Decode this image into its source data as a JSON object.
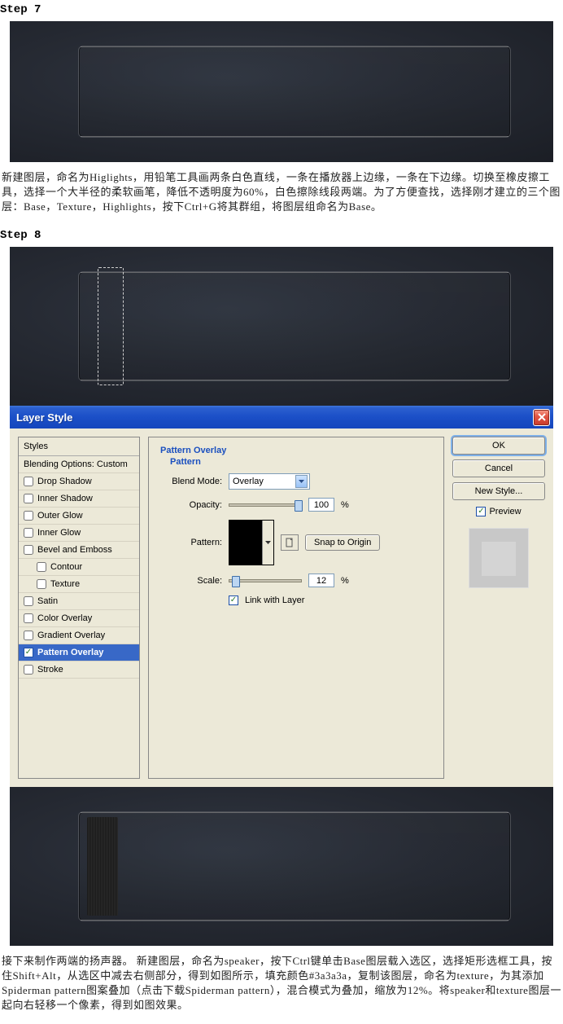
{
  "step7_heading": "Step 7",
  "step7_para": "新建图层，命名为Higlights，用铅笔工具画两条白色直线，一条在播放器上边缘，一条在下边缘。切换至橡皮擦工具，选择一个大半径的柔软画笔，降低不透明度为60%，白色擦除线段两端。为了方便查找，选择刚才建立的三个图层：Base，Texture，Highlights，按下Ctrl+G将其群组，将图层组命名为Base。",
  "step8_heading": "Step 8",
  "dialog": {
    "title": "Layer Style",
    "styles_header": "Styles",
    "blending_options": "Blending Options: Custom",
    "items": [
      "Drop Shadow",
      "Inner Shadow",
      "Outer Glow",
      "Inner Glow",
      "Bevel and Emboss",
      "Contour",
      "Texture",
      "Satin",
      "Color Overlay",
      "Gradient Overlay",
      "Pattern Overlay",
      "Stroke"
    ],
    "settings_title": "Pattern Overlay",
    "settings_subtitle": "Pattern",
    "blend_mode_label": "Blend Mode:",
    "blend_mode_value": "Overlay",
    "opacity_label": "Opacity:",
    "opacity_value": "100",
    "pattern_label": "Pattern:",
    "snap_origin": "Snap to Origin",
    "scale_label": "Scale:",
    "scale_value": "12",
    "link_layer": "Link with Layer",
    "pct": "%",
    "ok": "OK",
    "cancel": "Cancel",
    "new_style": "New Style...",
    "preview": "Preview"
  },
  "step8_para": "接下来制作两端的扬声器。 新建图层，命名为speaker，按下Ctrl键单击Base图层载入选区，选择矩形选框工具，按住Shift+Alt，从选区中减去右侧部分，得到如图所示，填充颜色#3a3a3a，复制该图层，命名为texture，为其添加Spiderman pattern图案叠加（点击下载Spiderman pattern），混合模式为叠加，缩放为12%。将speaker和texture图层一起向右轻移一个像素，得到如图效果。"
}
